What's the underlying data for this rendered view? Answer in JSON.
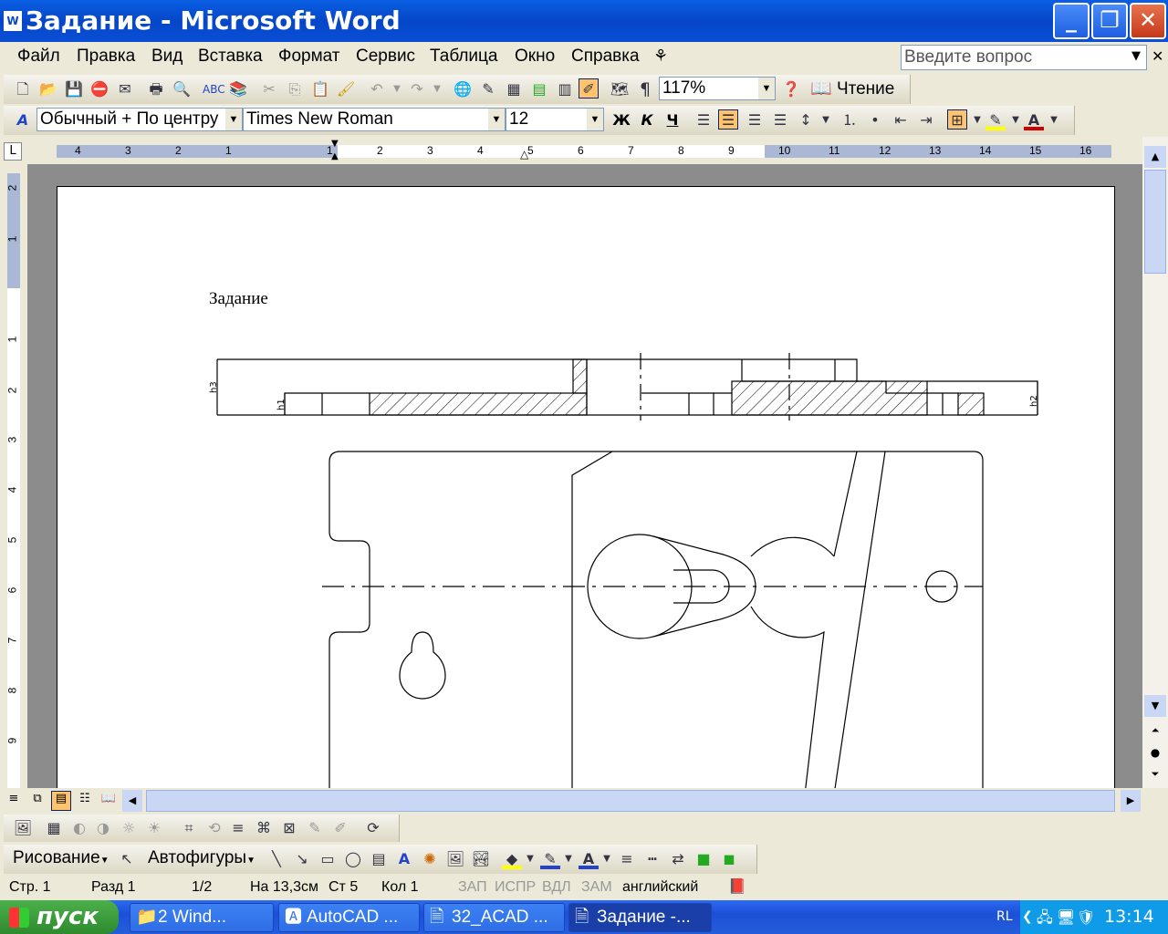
{
  "window": {
    "title": "Задание - Microsoft Word",
    "minimize": "_",
    "restore": "❐",
    "close": "✕"
  },
  "menu": {
    "items": [
      "Файл",
      "Правка",
      "Вид",
      "Вставка",
      "Формат",
      "Сервис",
      "Таблица",
      "Окно",
      "Справка"
    ],
    "ask_placeholder": "Введите вопрос"
  },
  "standard_toolbar": {
    "zoom": "117%",
    "reading_label": "Чтение"
  },
  "formatting_toolbar": {
    "style": "Обычный + По центру",
    "font": "Times New Roman",
    "size": "12",
    "bold": "Ж",
    "italic": "К",
    "underline": "Ч"
  },
  "ruler": {
    "h_labels": [
      "4",
      "3",
      "2",
      "1",
      "1",
      "2",
      "3",
      "4",
      "5",
      "6",
      "7",
      "8",
      "9",
      "10",
      "11",
      "12",
      "13",
      "14",
      "15",
      "16"
    ],
    "v_labels": [
      "2",
      "1",
      "1",
      "2",
      "3",
      "4",
      "5",
      "6",
      "7",
      "8",
      "9"
    ]
  },
  "document": {
    "heading": "Задание",
    "dim_h3": "h3",
    "dim_h1": "h1",
    "dim_h2": "h2"
  },
  "drawing_toolbar": {
    "drawing_label": "Рисование",
    "autoshapes_label": "Автофигуры"
  },
  "status": {
    "page": "Стр. 1",
    "section": "Разд 1",
    "pages": "1/2",
    "at": "На 13,3см",
    "line": "Ст 5",
    "col": "Кол 1",
    "rec": "ЗАП",
    "trk": "ИСПР",
    "ext": "ВДЛ",
    "ovr": "ЗАМ",
    "lang": "английский"
  },
  "taskbar": {
    "start": "пуск",
    "tasks": [
      "2 Wind...",
      "AutoCAD ...",
      "32_ACAD ...",
      "Задание -..."
    ],
    "lang": "RL",
    "clock": "13:14"
  },
  "colors": {
    "title_blue": "#0646c8",
    "ui_bg": "#ece9d8",
    "taskbar_blue": "#245edb",
    "start_green": "#2e8b2e",
    "highlight": "#ffc36b"
  }
}
